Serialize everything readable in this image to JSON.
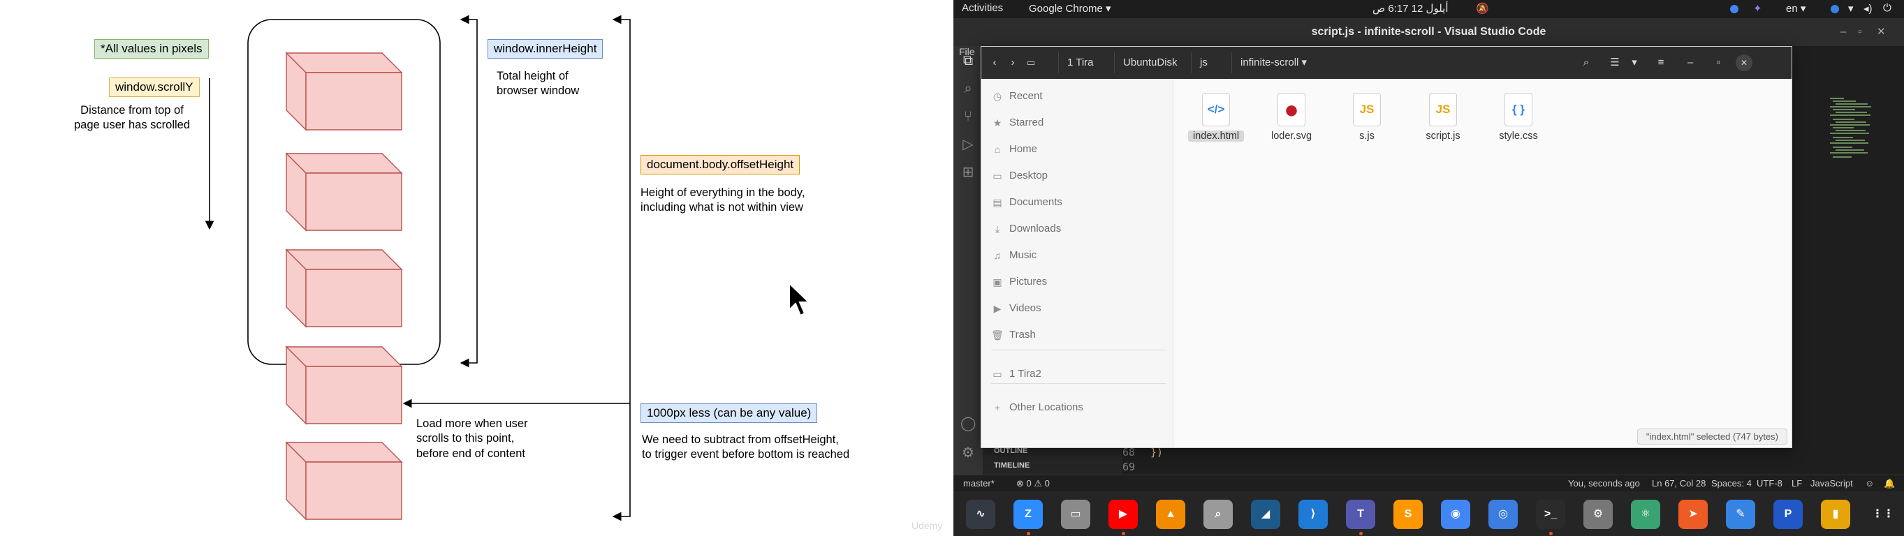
{
  "diagram": {
    "note_all_pixels": "*All values in pixels",
    "scrolly_label": "window.scrollY",
    "scrolly_desc": "Distance from top of\npage user has scrolled",
    "inner_height_label": "window.innerHeight",
    "inner_height_desc": "Total height of\nbrowser window",
    "offset_height_label": "document.body.offsetHeight",
    "offset_height_desc": "Height of everything in the body,\nincluding what is not within view",
    "load_more_desc": "Load more when user\nscrolls to this point,\nbefore end of content",
    "less_label": "1000px less (can be any value)",
    "less_desc": "We need to subtract from offsetHeight,\nto trigger event before bottom is reached",
    "watermark": "Udemy",
    "colors": {
      "box_fill": "#f8cecc",
      "box_stroke": "#b85450"
    }
  },
  "topbar": {
    "activities": "Activities",
    "app_menu": "Google Chrome ▾",
    "clock": "أيلول 12  6:17 ص",
    "lang": "en ▾"
  },
  "vscode": {
    "title": "script.js - infinite-scroll - Visual Studio Code",
    "menu_file": "File",
    "outline_label": "OUTLINE",
    "timeline_label": "TIMELINE",
    "line_68": "68",
    "line_69": "69",
    "status": {
      "branch": "master*",
      "errors": "⊗ 0 ⚠ 0",
      "blame": "You, seconds ago",
      "position": "Ln 67, Col 28",
      "spaces": "Spaces: 4",
      "encoding": "UTF-8",
      "eol": "LF",
      "language": "JavaScript"
    }
  },
  "files": {
    "breadcrumbs": [
      "1 Tira",
      "UbuntuDisk",
      "js",
      "infinite-scroll"
    ],
    "sidebar": [
      {
        "icon": "clock-icon",
        "glyph": "◷",
        "label": "Recent"
      },
      {
        "icon": "star-icon",
        "glyph": "★",
        "label": "Starred"
      },
      {
        "icon": "home-icon",
        "glyph": "⌂",
        "label": "Home"
      },
      {
        "icon": "desktop-icon",
        "glyph": "▭",
        "label": "Desktop"
      },
      {
        "icon": "documents-icon",
        "glyph": "▤",
        "label": "Documents"
      },
      {
        "icon": "downloads-icon",
        "glyph": "⤓",
        "label": "Downloads"
      },
      {
        "icon": "music-icon",
        "glyph": "♫",
        "label": "Music"
      },
      {
        "icon": "pictures-icon",
        "glyph": "▣",
        "label": "Pictures"
      },
      {
        "icon": "videos-icon",
        "glyph": "▶",
        "label": "Videos"
      },
      {
        "icon": "trash-icon",
        "glyph": "🗑",
        "label": "Trash"
      },
      {
        "icon": "drive-icon",
        "glyph": "▭",
        "label": "1 Tira2"
      },
      {
        "icon": "plus-icon",
        "glyph": "+",
        "label": "Other Locations"
      }
    ],
    "items": [
      {
        "name": "index.html",
        "glyph": "</>",
        "color": "#3584e4",
        "selected": true
      },
      {
        "name": "loder.svg",
        "glyph": "●",
        "color": "#c01c28",
        "selected": false
      },
      {
        "name": "s.js",
        "glyph": "JS",
        "color": "#e5a50a",
        "selected": false
      },
      {
        "name": "script.js",
        "glyph": "JS",
        "color": "#e5a50a",
        "selected": false
      },
      {
        "name": "style.css",
        "glyph": "{ }",
        "color": "#3584e4",
        "selected": false
      }
    ],
    "status": "\"index.html\" selected  (747 bytes)"
  },
  "dock": [
    {
      "name": "system-monitor-icon",
      "glyph": "∿",
      "bg": "#333a44"
    },
    {
      "name": "zoom-icon",
      "glyph": "Z",
      "bg": "#2d8cff"
    },
    {
      "name": "files-icon",
      "glyph": "▭",
      "bg": "#8a8a8a"
    },
    {
      "name": "youtube-icon",
      "glyph": "▶",
      "bg": "#ff0000"
    },
    {
      "name": "vlc-icon",
      "glyph": "▲",
      "bg": "#f28a00"
    },
    {
      "name": "image-viewer-icon",
      "glyph": "⌕",
      "bg": "#9a9a9a"
    },
    {
      "name": "wireshark-icon",
      "glyph": "◢",
      "bg": "#1d5a8a"
    },
    {
      "name": "vscode-icon",
      "glyph": "⟩",
      "bg": "#1f7ad6"
    },
    {
      "name": "teams-icon",
      "glyph": "T",
      "bg": "#5558af"
    },
    {
      "name": "sublime-icon",
      "glyph": "S",
      "bg": "#ff9800"
    },
    {
      "name": "chrome-icon",
      "glyph": "◉",
      "bg": "#4285f4"
    },
    {
      "name": "chromium-icon",
      "glyph": "◎",
      "bg": "#3b7de0"
    },
    {
      "name": "terminal-icon",
      "glyph": ">_",
      "bg": "#2b2b2b"
    },
    {
      "name": "settings-icon",
      "glyph": "⚙",
      "bg": "#777777"
    },
    {
      "name": "atom-icon",
      "glyph": "⚛",
      "bg": "#3aa372"
    },
    {
      "name": "postman-icon",
      "glyph": "➤",
      "bg": "#ef5b25"
    },
    {
      "name": "text-editor-icon",
      "glyph": "✎",
      "bg": "#3584e4"
    },
    {
      "name": "pycharm-icon",
      "glyph": "P",
      "bg": "#2157c7"
    },
    {
      "name": "archive-icon",
      "glyph": "▮",
      "bg": "#e5a50a"
    },
    {
      "name": "app-grid-icon",
      "glyph": "⋮⋮",
      "bg": "#252525"
    }
  ]
}
